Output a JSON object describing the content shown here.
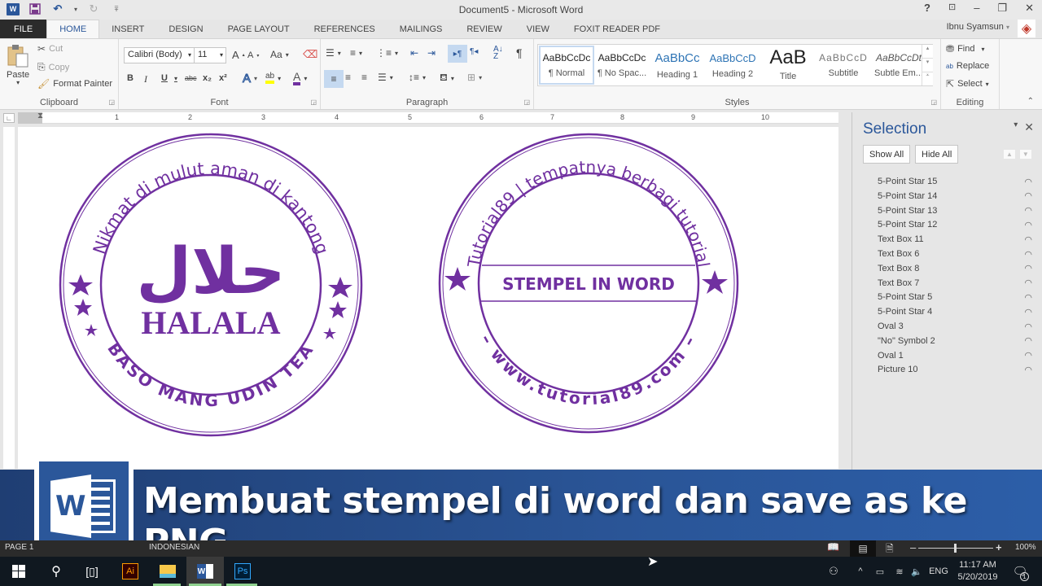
{
  "window": {
    "title": "Document5 - Microsoft Word",
    "user": "Ibnu Syamsun",
    "controls": [
      "?",
      "ribbon-display",
      "minimize",
      "restore",
      "close"
    ]
  },
  "quick_access": {
    "word_logo": "W",
    "items": [
      "save-icon",
      "undo-icon",
      "redo-icon",
      "customize-icon"
    ]
  },
  "tabs": [
    {
      "label": "FILE",
      "active": false
    },
    {
      "label": "HOME",
      "active": true
    },
    {
      "label": "INSERT",
      "active": false
    },
    {
      "label": "DESIGN",
      "active": false
    },
    {
      "label": "PAGE LAYOUT",
      "active": false
    },
    {
      "label": "REFERENCES",
      "active": false
    },
    {
      "label": "MAILINGS",
      "active": false
    },
    {
      "label": "REVIEW",
      "active": false
    },
    {
      "label": "VIEW",
      "active": false
    },
    {
      "label": "FOXIT READER PDF",
      "active": false
    }
  ],
  "ribbon": {
    "clipboard": {
      "label": "Clipboard",
      "paste": "Paste",
      "cut": "Cut",
      "copy": "Copy",
      "format_painter": "Format Painter"
    },
    "font": {
      "label": "Font",
      "font_name": "Calibri (Body)",
      "font_size": "11",
      "grow": "A",
      "shrink": "A",
      "change_case": "Aa",
      "bold": "B",
      "italic": "I",
      "underline": "U",
      "strikethrough": "abc",
      "subscript": "x₂",
      "superscript": "x²",
      "text_effects": "A",
      "highlight": "ab",
      "font_color": "A",
      "font_color_hex": "#7030a0",
      "highlight_hex": "#ffff00"
    },
    "paragraph": {
      "label": "Paragraph",
      "pilcrow": "¶"
    },
    "styles": {
      "label": "Styles",
      "items": [
        {
          "preview": "AaBbCcDc",
          "name": "¶ Normal",
          "selected": true
        },
        {
          "preview": "AaBbCcDc",
          "name": "¶ No Spac...",
          "selected": false
        },
        {
          "preview": "AaBbCc",
          "name": "Heading 1",
          "selected": false
        },
        {
          "preview": "AaBbCcD",
          "name": "Heading 2",
          "selected": false
        },
        {
          "preview": "AaB",
          "name": "Title",
          "selected": false
        },
        {
          "preview": "AaBbCcD",
          "name": "Subtitle",
          "selected": false
        },
        {
          "preview": "AaBbCcDt",
          "name": "Subtle Em...",
          "selected": false
        }
      ]
    },
    "editing": {
      "label": "Editing",
      "find": "Find",
      "replace": "Replace",
      "select": "Select"
    }
  },
  "ruler": {
    "numbers": [
      "1",
      "2",
      "3",
      "4",
      "5",
      "6",
      "7",
      "8",
      "9",
      "10"
    ]
  },
  "document": {
    "stamp_color": "#7030a0",
    "stamp1": {
      "top_text": "Nikmat di mulut aman di kantong",
      "bottom_text": "BASO MANG UDIN TEA",
      "arabic": "حلال",
      "center_text": "HALALA"
    },
    "stamp2": {
      "top_text": "Tutorial89 | tempatnya berbagi tutorial",
      "bottom_text": "– www.tutorial89.com –",
      "center_text": "STEMPEL IN WORD"
    }
  },
  "selection_pane": {
    "title": "Selection",
    "show_all": "Show All",
    "hide_all": "Hide All",
    "items": [
      "5-Point Star 15",
      "5-Point Star 14",
      "5-Point Star 13",
      "5-Point Star 12",
      "Text Box 11",
      "Text Box 6",
      "Text Box 8",
      "Text Box 7",
      "5-Point Star 5",
      "5-Point Star 4",
      "Oval 3",
      "\"No\" Symbol 2",
      "Oval 1",
      "Picture 10"
    ]
  },
  "banner": {
    "text": "Membuat stempel di word dan save as ke PNG",
    "logo": "W"
  },
  "statusbar": {
    "page": "PAGE 1",
    "language": "INDONESIAN",
    "zoom": "100%",
    "zoom_percent": 100
  },
  "taskbar": {
    "apps": [
      "start",
      "search",
      "task-view",
      "illustrator",
      "file-explorer",
      "word",
      "photoshop"
    ],
    "illustrator_label": "Ai",
    "photoshop_label": "Ps",
    "word_label": "W",
    "language": "ENG",
    "time": "11:17 AM",
    "date": "5/20/2019",
    "notifications": "1"
  }
}
